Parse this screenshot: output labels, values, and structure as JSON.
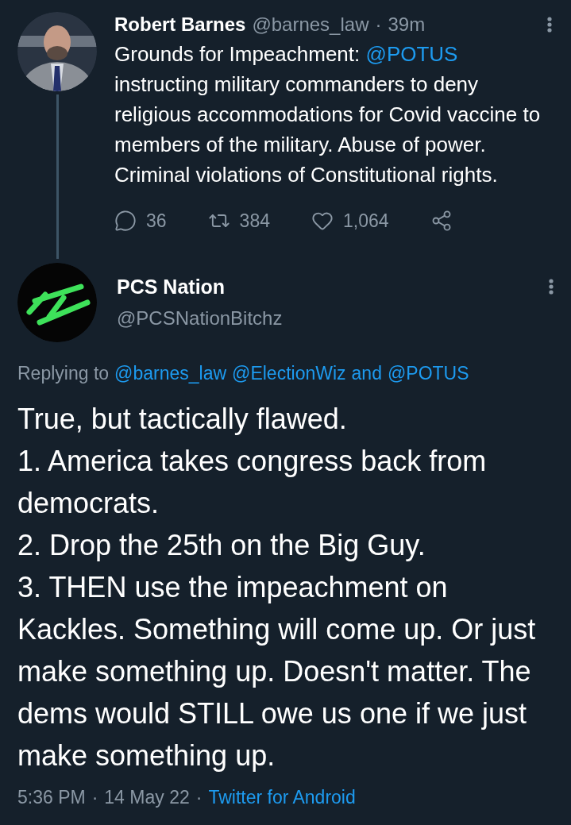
{
  "tweets": [
    {
      "author": {
        "name": "Robert Barnes",
        "handle": "@barnes_law"
      },
      "time": "39m",
      "separator": "·",
      "text": {
        "before": "Grounds for Impeachment: ",
        "mention": "@POTUS",
        "after": " instructing military commanders to deny religious accommodations for Covid vaccine to members of the military. Abuse of power. Criminal violations of Constitutional rights."
      },
      "actions": [
        {
          "kind": "reply",
          "count": "36"
        },
        {
          "kind": "retweet",
          "count": "384"
        },
        {
          "kind": "like",
          "count": "1,064"
        },
        {
          "kind": "share"
        }
      ]
    }
  ],
  "reply": {
    "author": {
      "name": "PCS Nation",
      "handle": "@PCSNationBitchz"
    },
    "replying_to": {
      "label": "Replying to",
      "mentions": [
        "@barnes_law",
        "@ElectionWiz"
      ],
      "conjunction": "and",
      "last": "@POTUS"
    },
    "body": "True, but tactically flawed.\n1. America takes congress back from democrats.\n2. Drop the 25th on the Big Guy.\n3. THEN use the impeachment on Kackles. Something will come up. Or just make something up. Doesn't matter. The dems would STILL owe us one if we just make something up.",
    "footer": {
      "time": "5:36 PM",
      "separator": "·",
      "date": "14 May 22",
      "source": "Twitter for Android"
    }
  }
}
